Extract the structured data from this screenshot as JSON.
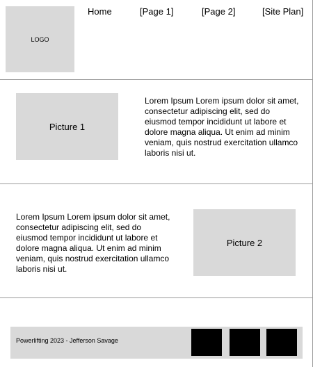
{
  "header": {
    "logo_text": "LOGO",
    "nav": [
      {
        "label": "Home"
      },
      {
        "label": "[Page 1]"
      },
      {
        "label": "[Page 2]"
      },
      {
        "label": "[Site Plan]"
      }
    ]
  },
  "section1": {
    "picture_label": "Picture 1",
    "text": "Lorem Ipsum Lorem ipsum dolor sit amet, consectetur adipiscing elit, sed do eiusmod tempor incididunt ut labore et dolore magna aliqua. Ut enim ad minim veniam, quis nostrud exercitation ullamco laboris nisi ut."
  },
  "section2": {
    "picture_label": "Picture 2",
    "text": "Lorem Ipsum Lorem ipsum dolor sit amet, consectetur adipiscing elit, sed do eiusmod tempor incididunt ut labore et dolore magna aliqua. Ut enim ad minim veniam, quis nostrud exercitation ullamco laboris nisi ut."
  },
  "footer": {
    "text": "Powerlifting 2023 - Jefferson Savage",
    "social_color": "#000000",
    "bar_color": "#d9d9d9"
  }
}
